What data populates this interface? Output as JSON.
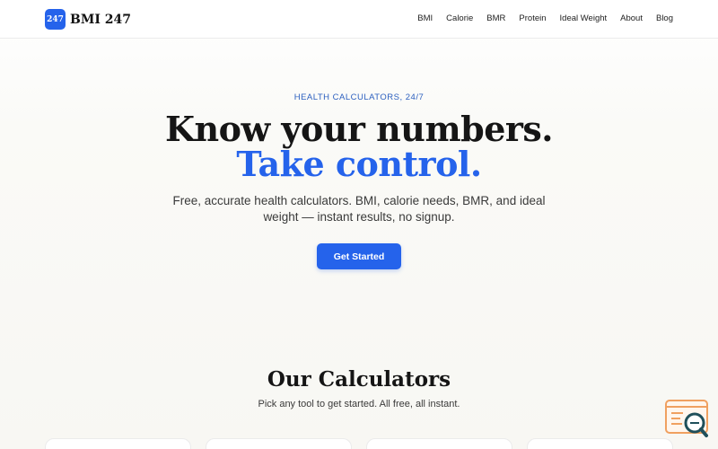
{
  "brand": {
    "logo_text": "247",
    "name": "BMI 247",
    "accent_color": "#2563eb"
  },
  "nav": {
    "items": [
      {
        "label": "BMI"
      },
      {
        "label": "Calorie"
      },
      {
        "label": "BMR"
      },
      {
        "label": "Protein"
      },
      {
        "label": "Ideal Weight"
      },
      {
        "label": "About"
      },
      {
        "label": "Blog"
      }
    ]
  },
  "hero": {
    "eyebrow": "HEALTH CALCULATORS, 24/7",
    "headline_line1": "Know your numbers.",
    "headline_line2": "Take control.",
    "subtitle": "Free, accurate health calculators. BMI, calorie needs, BMR, and ideal weight — instant results, no signup.",
    "cta_label": "Get Started"
  },
  "calculators": {
    "title": "Our Calculators",
    "subtitle": "Pick any tool to get started. All free, all instant."
  },
  "widget": {
    "icon": "search-chat-icon"
  }
}
